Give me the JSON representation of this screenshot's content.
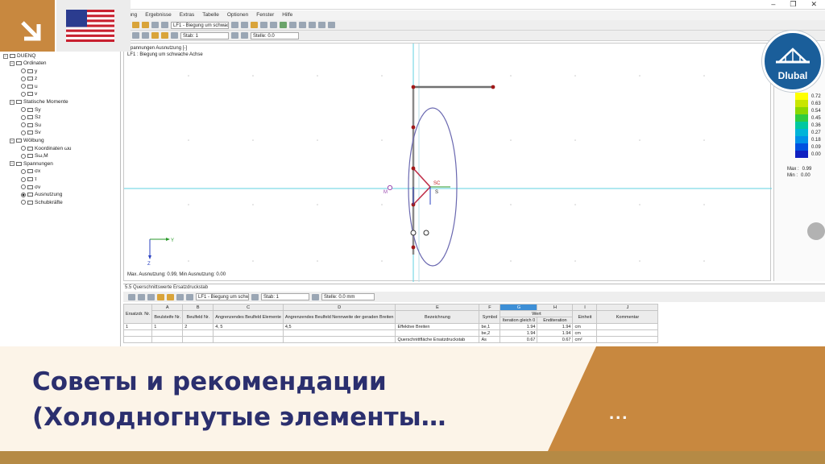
{
  "menu": [
    "...ung",
    "Ergebnisse",
    "Extras",
    "Tabelle",
    "Optionen",
    "Fenster",
    "Hilfe"
  ],
  "toolbar": {
    "loadcase": "LF1 - Biegung um schwach",
    "member_label": "Stab: 1",
    "location_label": "Stelle: 0.0"
  },
  "navigator": {
    "root": "DUENQ",
    "items": [
      {
        "label": "Ordinaten",
        "level": 1,
        "kind": "folder"
      },
      {
        "label": "y",
        "level": 2,
        "kind": "radio"
      },
      {
        "label": "z",
        "level": 2,
        "kind": "radio"
      },
      {
        "label": "u",
        "level": 2,
        "kind": "radio"
      },
      {
        "label": "v",
        "level": 2,
        "kind": "radio"
      },
      {
        "label": "Statische Momente",
        "level": 1,
        "kind": "folder"
      },
      {
        "label": "Sy",
        "level": 2,
        "kind": "radio"
      },
      {
        "label": "Sz",
        "level": 2,
        "kind": "radio"
      },
      {
        "label": "Su",
        "level": 2,
        "kind": "radio"
      },
      {
        "label": "Sv",
        "level": 2,
        "kind": "radio"
      },
      {
        "label": "Wölbung",
        "level": 1,
        "kind": "folder"
      },
      {
        "label": "Koordinaten ωu",
        "level": 2,
        "kind": "radio"
      },
      {
        "label": "Sω,M",
        "level": 2,
        "kind": "radio"
      },
      {
        "label": "Spannungen",
        "level": 1,
        "kind": "folder"
      },
      {
        "label": "σx",
        "level": 2,
        "kind": "radio"
      },
      {
        "label": "τ",
        "level": 2,
        "kind": "radio"
      },
      {
        "label": "σv",
        "level": 2,
        "kind": "radio"
      },
      {
        "label": "Ausnutzung",
        "level": 2,
        "kind": "radio",
        "selected": true
      },
      {
        "label": "Schubkräfte",
        "level": 2,
        "kind": "radio"
      }
    ]
  },
  "graphics": {
    "header1": "Spannungen Ausnutzung [-]",
    "header2": "LF1 : Biegung um schwache Achse",
    "footer": "Max. Ausnutzung: 0.99, Min Ausnutzung: 0.00",
    "axis_y": "Y",
    "axis_z": "Z",
    "label_sc": "SC",
    "label_s": "S",
    "label_m": "M"
  },
  "legend": {
    "values": [
      "0.72",
      "0.63",
      "0.54",
      "0.45",
      "0.36",
      "0.27",
      "0.18",
      "0.09",
      "0.00"
    ],
    "colors": [
      "#ffff00",
      "#c8e600",
      "#8ad800",
      "#2ecc40",
      "#00c8a0",
      "#00b4d8",
      "#0090e8",
      "#0050e0",
      "#1020c0"
    ],
    "max_label": "Max :",
    "max_value": "0.99",
    "min_label": "Min :",
    "min_value": "0.00"
  },
  "badge": {
    "text": "Dlubal"
  },
  "table": {
    "title": "5.5 Querschnittswerte Ersatzdruckstab",
    "loadcase": "LF1 - Biegung um schw",
    "member": "Stab: 1",
    "location": "Stelle: 0.0 mm",
    "col_letters": [
      "A",
      "B",
      "C",
      "D",
      "E",
      "F",
      "G",
      "H",
      "I",
      "J"
    ],
    "headers": {
      "ersatz": "Ersatzdr. Nr.",
      "a": "Beulsteife Nr.",
      "b": "Beulfeld Nr.",
      "c": "Angrenzendes Beulfeld Elemente",
      "d": "Angrenzendes Beulfeld Nennweite der geraden Breiten",
      "e": "Bezeichnung",
      "f": "Symbol",
      "g_group": "Wert",
      "g": "Iteration gleich 0",
      "h": "Enditeration",
      "i": "Einheit",
      "j": "Kommentar"
    },
    "rows": [
      {
        "nr": "1",
        "a": "1",
        "b": "2",
        "c": "4, 5",
        "d": "4,5",
        "e": "Effektive Breiten",
        "f": "be,1",
        "g": "1.94",
        "h": "1.94",
        "i": "cm",
        "j": ""
      },
      {
        "nr": "",
        "a": "",
        "b": "",
        "c": "",
        "d": "",
        "e": "",
        "f": "be,2",
        "g": "1.94",
        "h": "1.94",
        "i": "cm",
        "j": ""
      },
      {
        "nr": "",
        "a": "",
        "b": "",
        "c": "",
        "d": "",
        "e": "Querschnittfläche Ersatzdruckstab",
        "f": "As",
        "g": "0.67",
        "h": "0.67",
        "i": "cm²",
        "j": ""
      }
    ]
  },
  "banner": {
    "line1": "Советы и рекомендации",
    "line2": "(Холодногнутые элементы…",
    "dots": "..."
  }
}
